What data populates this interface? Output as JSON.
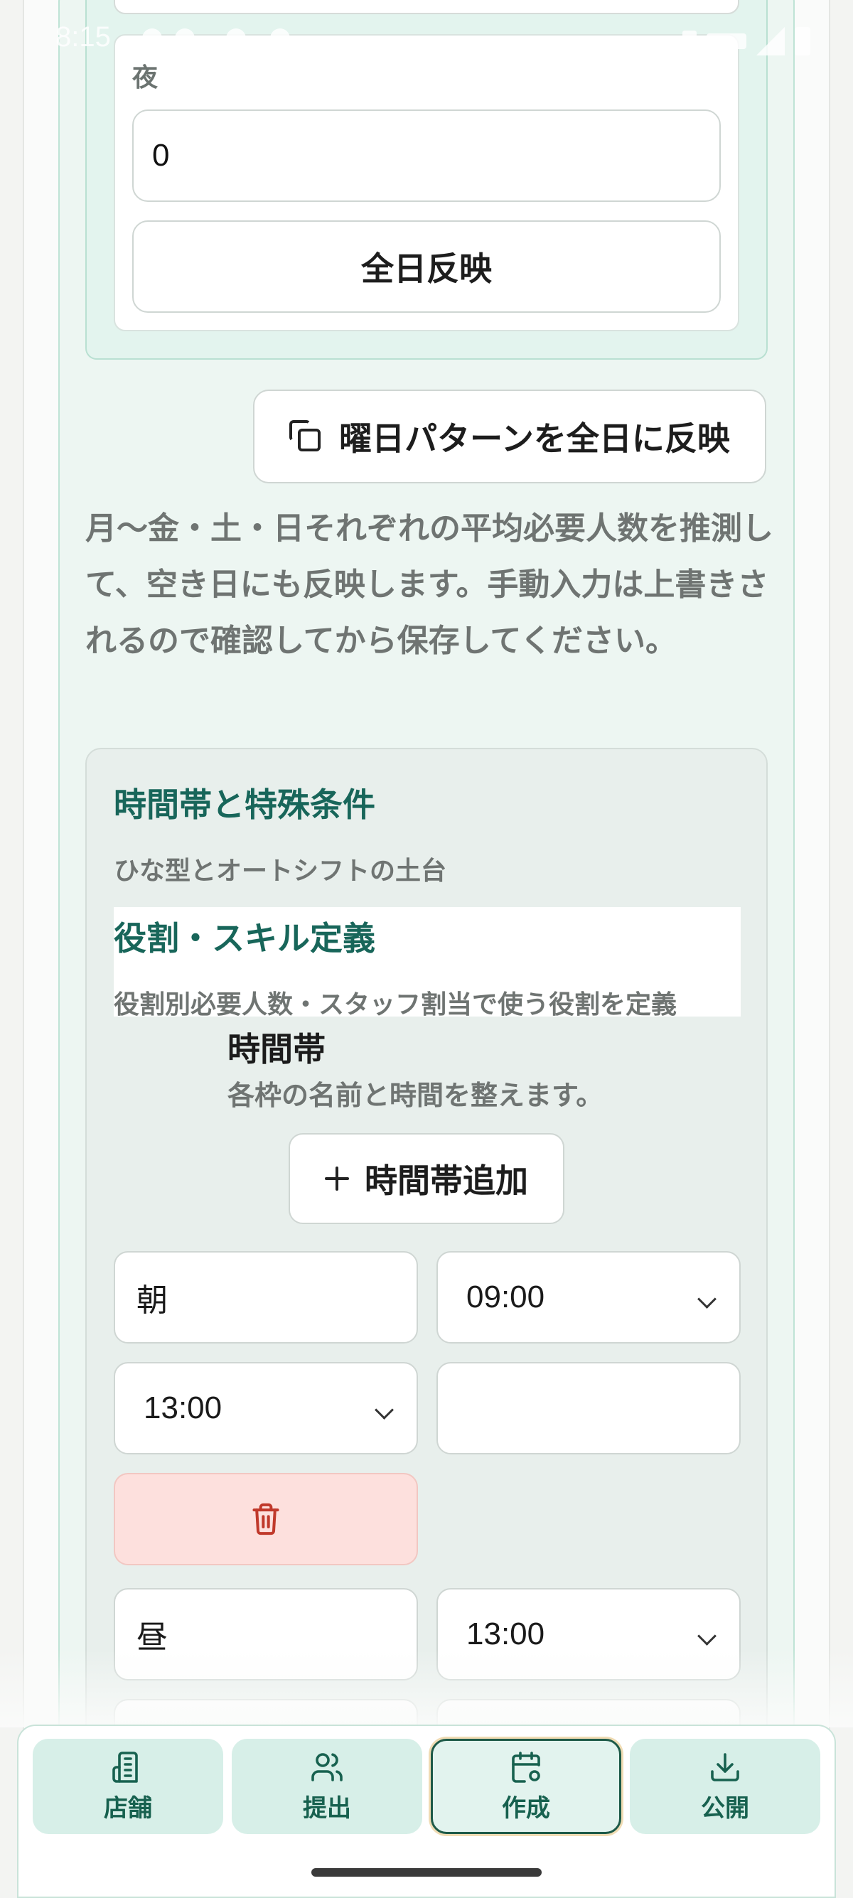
{
  "status_bar": {
    "time": "8:15"
  },
  "night_section": {
    "label": "夜",
    "value": "0",
    "apply_all_day_label": "全日反映"
  },
  "weekday_pattern_button": "曜日パターンを全日に反映",
  "description": "月〜金・土・日それぞれの平均必要人数を推測して、空き日にも反映します。手動入力は上書きされるので確認してから保存してください。",
  "time_conditions": {
    "title": "時間帯と特殊条件",
    "subtitle": "ひな型とオートシフトの土台",
    "role_title": "役割・スキル定義",
    "role_subtitle": "役割別必要人数・スタッフ割当で使う役割を定義",
    "slot_heading": "時間帯",
    "slot_subheading": "各枠の名前と時間を整えます。",
    "add_slot_label": "時間帯追加",
    "slots": [
      {
        "name": "朝",
        "start": "09:00",
        "end": "13:00",
        "extra": ""
      },
      {
        "name": "昼",
        "start": "13:00"
      }
    ]
  },
  "bottom_nav": {
    "items": [
      {
        "label": "店舗",
        "icon": "building-icon"
      },
      {
        "label": "提出",
        "icon": "users-icon"
      },
      {
        "label": "作成",
        "icon": "calendar-gear-icon",
        "active": true
      },
      {
        "label": "公開",
        "icon": "download-icon"
      }
    ]
  },
  "colors": {
    "accent": "#18665a",
    "nav_bg": "#d7efe8",
    "delete_bg": "#fde0dd",
    "delete_icon": "#c0392b"
  }
}
